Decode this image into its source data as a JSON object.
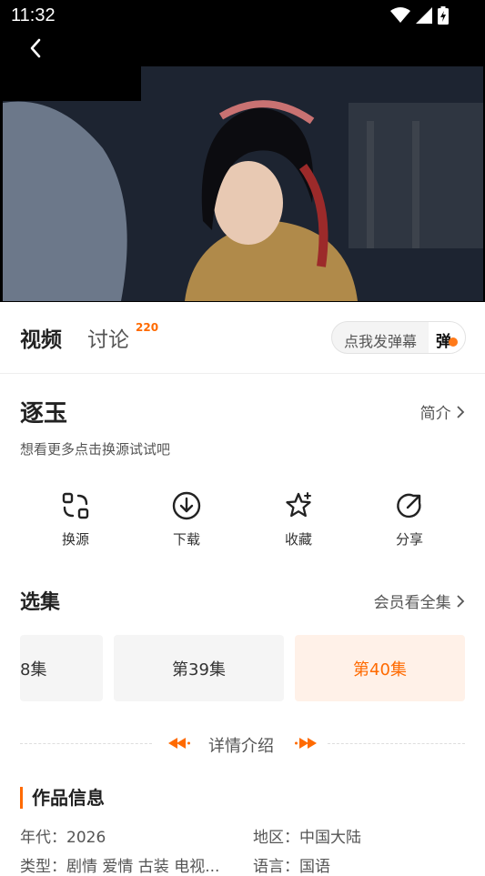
{
  "status_bar": {
    "time": "11:32"
  },
  "tabs": {
    "video": "视频",
    "discuss": "讨论",
    "discuss_count": "220"
  },
  "danmaku": {
    "placeholder": "点我发弹幕",
    "button": "弹"
  },
  "show": {
    "title": "逐玉",
    "intro_link": "简介",
    "hint": "想看更多点击换源试试吧"
  },
  "actions": [
    {
      "label": "换源",
      "icon": "switch-source-icon"
    },
    {
      "label": "下载",
      "icon": "download-icon"
    },
    {
      "label": "收藏",
      "icon": "star-icon"
    },
    {
      "label": "分享",
      "icon": "share-icon"
    }
  ],
  "episodes": {
    "title": "选集",
    "vip_link": "会员看全集",
    "items": [
      "8集",
      "第39集",
      "第40集"
    ],
    "active_index": 2
  },
  "detail_label": "详情介绍",
  "work_info": {
    "title": "作品信息",
    "year": "年代：2026",
    "region": "地区：中国大陆",
    "genre": "类型：剧情 爱情 古装 电视...",
    "language": "语言：国语"
  },
  "colors": {
    "accent": "#ff6a00",
    "text": "#222222",
    "muted": "#555555"
  }
}
